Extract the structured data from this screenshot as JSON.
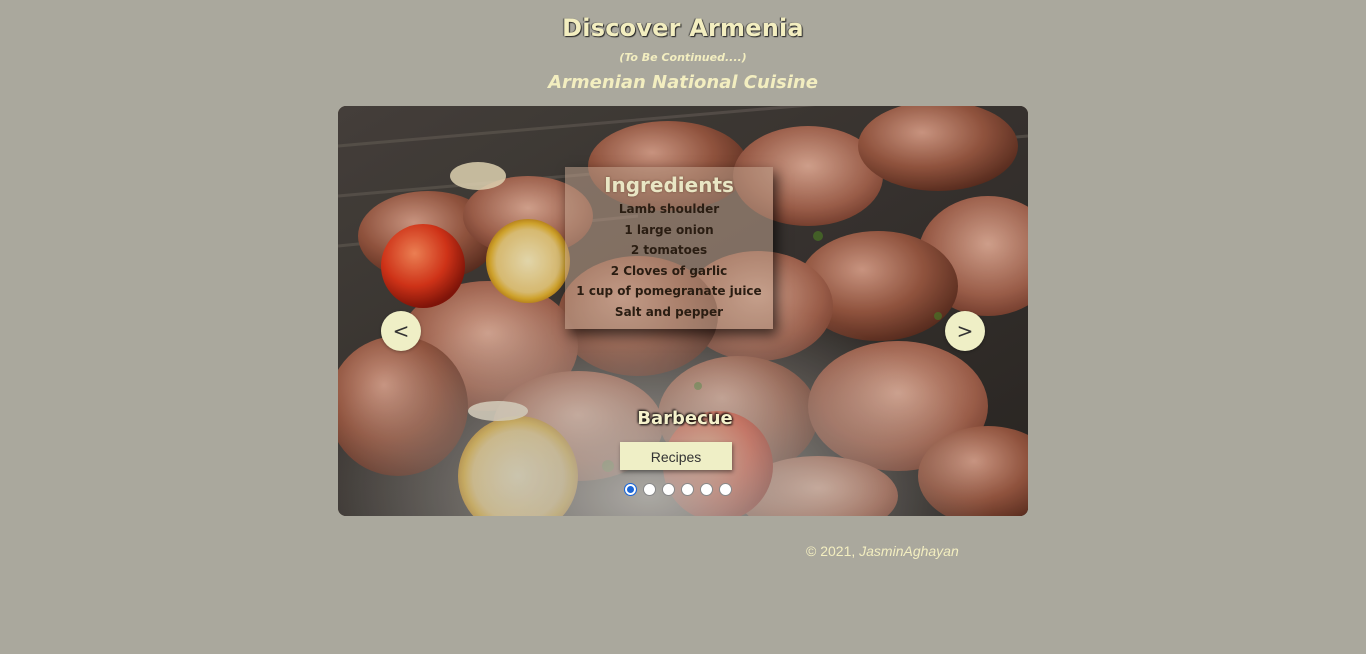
{
  "header": {
    "title": "Discover Armenia",
    "note": "(To Be Continued....)",
    "subtitle": "Armenian National Cuisine"
  },
  "carousel": {
    "prev_label": "<",
    "next_label": ">",
    "ingredients": {
      "title": "Ingredients",
      "items": [
        "Lamb shoulder",
        "1 large onion",
        "2 tomatoes",
        "2 Cloves of garlic",
        "1 cup of pomegranate juice",
        "Salt and pepper"
      ]
    },
    "caption": "Barbecue",
    "button_label": "Recipes",
    "slide_count": 6,
    "active_slide": 1
  },
  "footer": {
    "copyright": "© 2021, ",
    "author": "JasminAghayan"
  },
  "colors": {
    "background": "#aaa89d",
    "accent_text": "#f3eec0",
    "button": "#efefc6",
    "active_dot": "#1a66d8"
  }
}
